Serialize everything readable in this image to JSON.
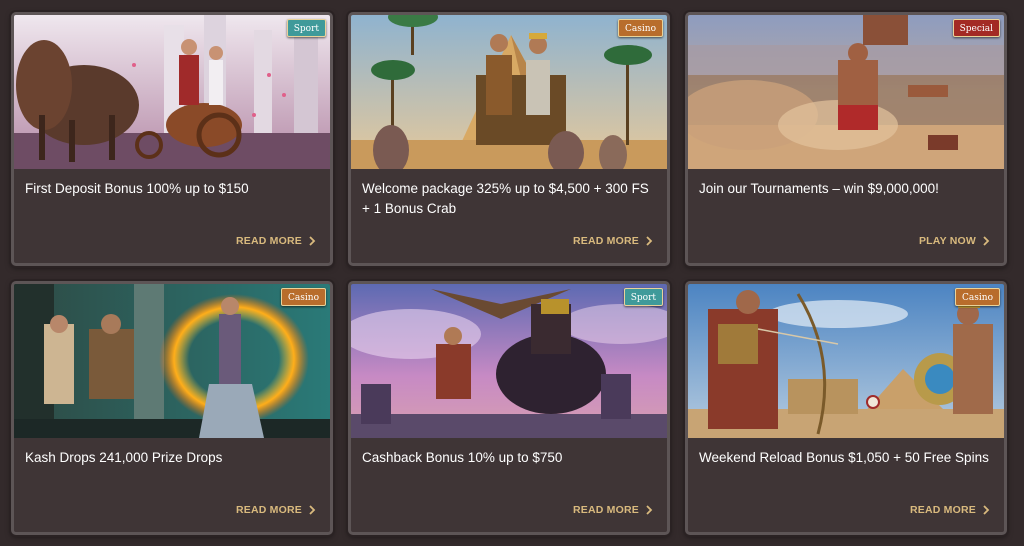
{
  "colors": {
    "sport": "#3f9a9a",
    "casino": "#b86d2c",
    "special": "#a32a24",
    "link": "#d9ba7e",
    "card_bg": "#3f3536",
    "page_bg": "#332a2b"
  },
  "cards": [
    {
      "badge": "Sport",
      "badge_type": "sport",
      "title": "First Deposit Bonus 100% up to $150",
      "cta": "READ MORE",
      "image": "chariot-gladiator-illustration"
    },
    {
      "badge": "Casino",
      "badge_type": "casino",
      "title": "Welcome package 325% up to $4,500 + 300 FS + 1 Bonus Crab",
      "cta": "READ MORE",
      "image": "pharaoh-pyramid-illustration"
    },
    {
      "badge": "Special",
      "badge_type": "special",
      "title": "Join our Tournaments – win $9,000,000!",
      "cta": "PLAY NOW",
      "image": "arena-wrestler-illustration"
    },
    {
      "badge": "Casino",
      "badge_type": "casino",
      "title": "Kash Drops 241,000 Prize Drops",
      "cta": "READ MORE",
      "image": "fire-dancer-illustration"
    },
    {
      "badge": "Sport",
      "badge_type": "sport",
      "title": "Cashback Bonus 10% up to $750",
      "cta": "READ MORE",
      "image": "warrior-horse-eagle-illustration"
    },
    {
      "badge": "Casino",
      "badge_type": "casino",
      "title": "Weekend Reload Bonus $1,050 + 50 Free Spins",
      "cta": "READ MORE",
      "image": "archer-pyramid-illustration"
    }
  ]
}
